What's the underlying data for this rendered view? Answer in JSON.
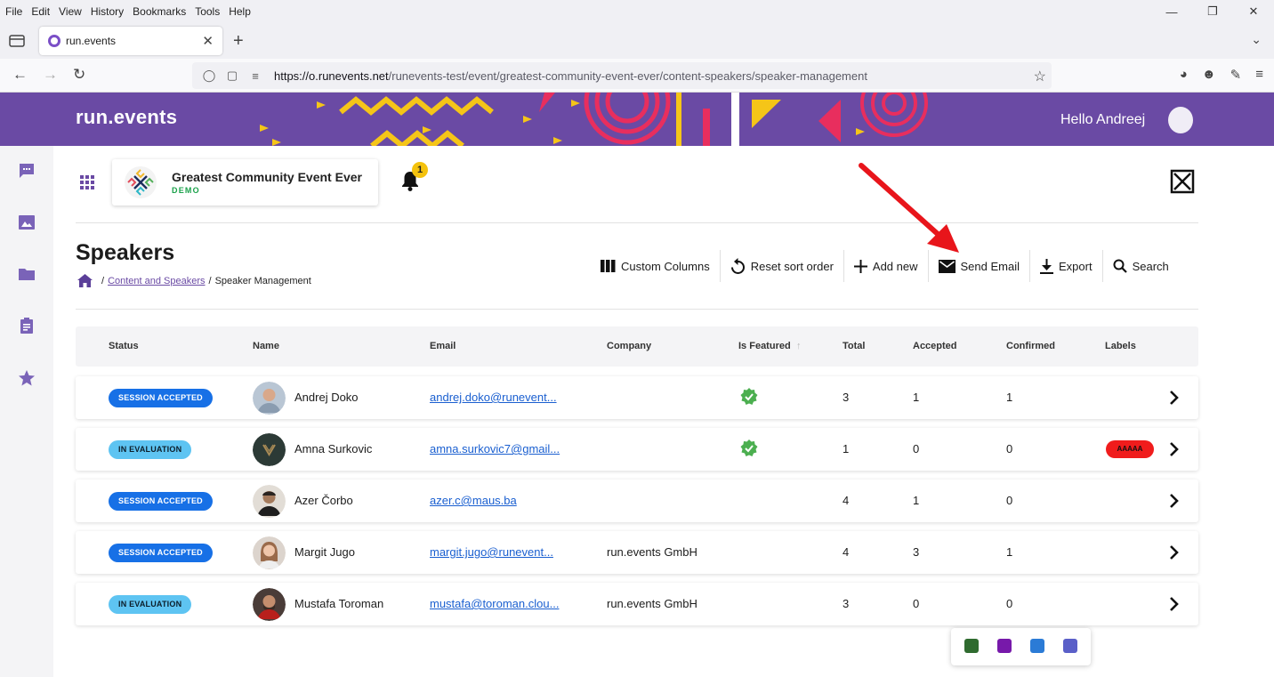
{
  "browser": {
    "menu": [
      "File",
      "Edit",
      "View",
      "History",
      "Bookmarks",
      "Tools",
      "Help"
    ],
    "tab_title": "run.events",
    "url_host": "https://o.runevents.net",
    "url_path": "/runevents-test/event/greatest-community-event-ever/content-speakers/speaker-management"
  },
  "app": {
    "logo": "run.events",
    "greeting": "Hello Andreej"
  },
  "event": {
    "name": "Greatest Community Event Ever",
    "tag": "DEMO",
    "notifications": "1"
  },
  "page": {
    "title": "Speakers",
    "breadcrumb": {
      "section": "Content and Speakers",
      "separator": "/",
      "current": "Speaker Management"
    }
  },
  "toolbar": {
    "custom_columns": "Custom Columns",
    "reset_sort": "Reset sort order",
    "add_new": "Add new",
    "send_email": "Send Email",
    "export": "Export",
    "search": "Search"
  },
  "table": {
    "columns": [
      "Status",
      "Name",
      "Email",
      "Company",
      "Is Featured",
      "Total",
      "Accepted",
      "Confirmed",
      "Labels"
    ],
    "sort": {
      "column": "Is Featured",
      "direction": "ascending"
    },
    "rows": [
      {
        "status": "SESSION ACCEPTED",
        "name": "Andrej Doko",
        "email": "andrej.doko@runevent...",
        "company": "",
        "featured": true,
        "total": "3",
        "accepted": "1",
        "confirmed": "1",
        "label": ""
      },
      {
        "status": "IN EVALUATION",
        "name": "Amna Surkovic",
        "email": "amna.surkovic7@gmail...",
        "company": "",
        "featured": true,
        "total": "1",
        "accepted": "0",
        "confirmed": "0",
        "label": "AAAAA"
      },
      {
        "status": "SESSION ACCEPTED",
        "name": "Azer Čorbo",
        "email": "azer.c@maus.ba",
        "company": "",
        "featured": false,
        "total": "4",
        "accepted": "1",
        "confirmed": "0",
        "label": ""
      },
      {
        "status": "SESSION ACCEPTED",
        "name": "Margit Jugo",
        "email": "margit.jugo@runevent...",
        "company": "run.events GmbH",
        "featured": false,
        "total": "4",
        "accepted": "3",
        "confirmed": "1",
        "label": ""
      },
      {
        "status": "IN EVALUATION",
        "name": "Mustafa Toroman",
        "email": "mustafa@toroman.clou...",
        "company": "run.events GmbH",
        "featured": false,
        "total": "3",
        "accepted": "0",
        "confirmed": "0",
        "label": ""
      }
    ]
  },
  "colors": {
    "brand": "#6a4aa4",
    "status_accepted": "#1770e6",
    "status_evaluation": "#5ec4f2",
    "featured_check": "#4caf50",
    "label_red": "#f01c1c",
    "annotation_arrow": "#e8151b"
  },
  "icons": [
    "grid-icon",
    "bell-icon",
    "close-icon",
    "home-icon",
    "columns-icon",
    "reset-icon",
    "plus-icon",
    "mail-icon",
    "download-icon",
    "search-icon",
    "check-badge-icon",
    "chevron-right-icon",
    "chat-icon",
    "image-icon",
    "folder-icon",
    "clipboard-icon",
    "star-icon"
  ]
}
